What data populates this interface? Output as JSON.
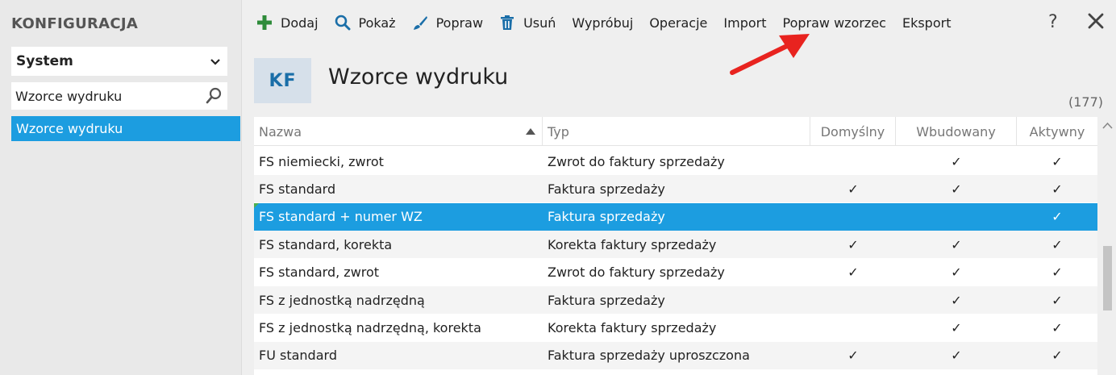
{
  "app": {
    "title": "KONFIGURACJA"
  },
  "sidebar": {
    "select_value": "System",
    "search_value": "Wzorce wydruku",
    "items": [
      {
        "label": "Wzorce wydruku",
        "selected": true
      }
    ]
  },
  "toolbar": {
    "add": "Dodaj",
    "show": "Pokaż",
    "edit": "Popraw",
    "delete": "Usuń",
    "try": "Wypróbuj",
    "operations": "Operacje",
    "import": "Import",
    "edit_template": "Popraw wzorzec",
    "export": "Eksport",
    "help": "?"
  },
  "header": {
    "badge": "KF",
    "title": "Wzorce wydruku",
    "count": "(177)"
  },
  "table": {
    "columns": {
      "name": "Nazwa",
      "type": "Typ",
      "default": "Domyślny",
      "builtin": "Wbudowany",
      "active": "Aktywny"
    },
    "check_glyph": "✓",
    "rows": [
      {
        "name": "FS niemiecki, zwrot",
        "type": "Zwrot do faktury sprzedaży",
        "default": false,
        "builtin": true,
        "active": true
      },
      {
        "name": "FS standard",
        "type": "Faktura sprzedaży",
        "default": true,
        "builtin": true,
        "active": true
      },
      {
        "name": "FS standard + numer WZ",
        "type": "Faktura sprzedaży",
        "default": false,
        "builtin": false,
        "active": true,
        "selected": true
      },
      {
        "name": "FS standard, korekta",
        "type": "Korekta faktury sprzedaży",
        "default": true,
        "builtin": true,
        "active": true
      },
      {
        "name": "FS standard, zwrot",
        "type": "Zwrot do faktury sprzedaży",
        "default": true,
        "builtin": true,
        "active": true
      },
      {
        "name": "FS z jednostką nadrzędną",
        "type": "Faktura sprzedaży",
        "default": false,
        "builtin": true,
        "active": true
      },
      {
        "name": "FS z jednostką nadrzędną, korekta",
        "type": "Korekta faktury sprzedaży",
        "default": false,
        "builtin": true,
        "active": true
      },
      {
        "name": "FU standard",
        "type": "Faktura sprzedaży uproszczona",
        "default": true,
        "builtin": true,
        "active": true
      }
    ]
  },
  "colors": {
    "accent": "#1c9de0",
    "add_icon": "#2e8b3a",
    "icon_blue": "#1a6ea8",
    "arrow": "#e8231f"
  },
  "icons": {
    "add": "plus-icon",
    "show": "search-icon",
    "edit": "brush-icon",
    "delete": "trash-icon",
    "close": "close-icon"
  }
}
